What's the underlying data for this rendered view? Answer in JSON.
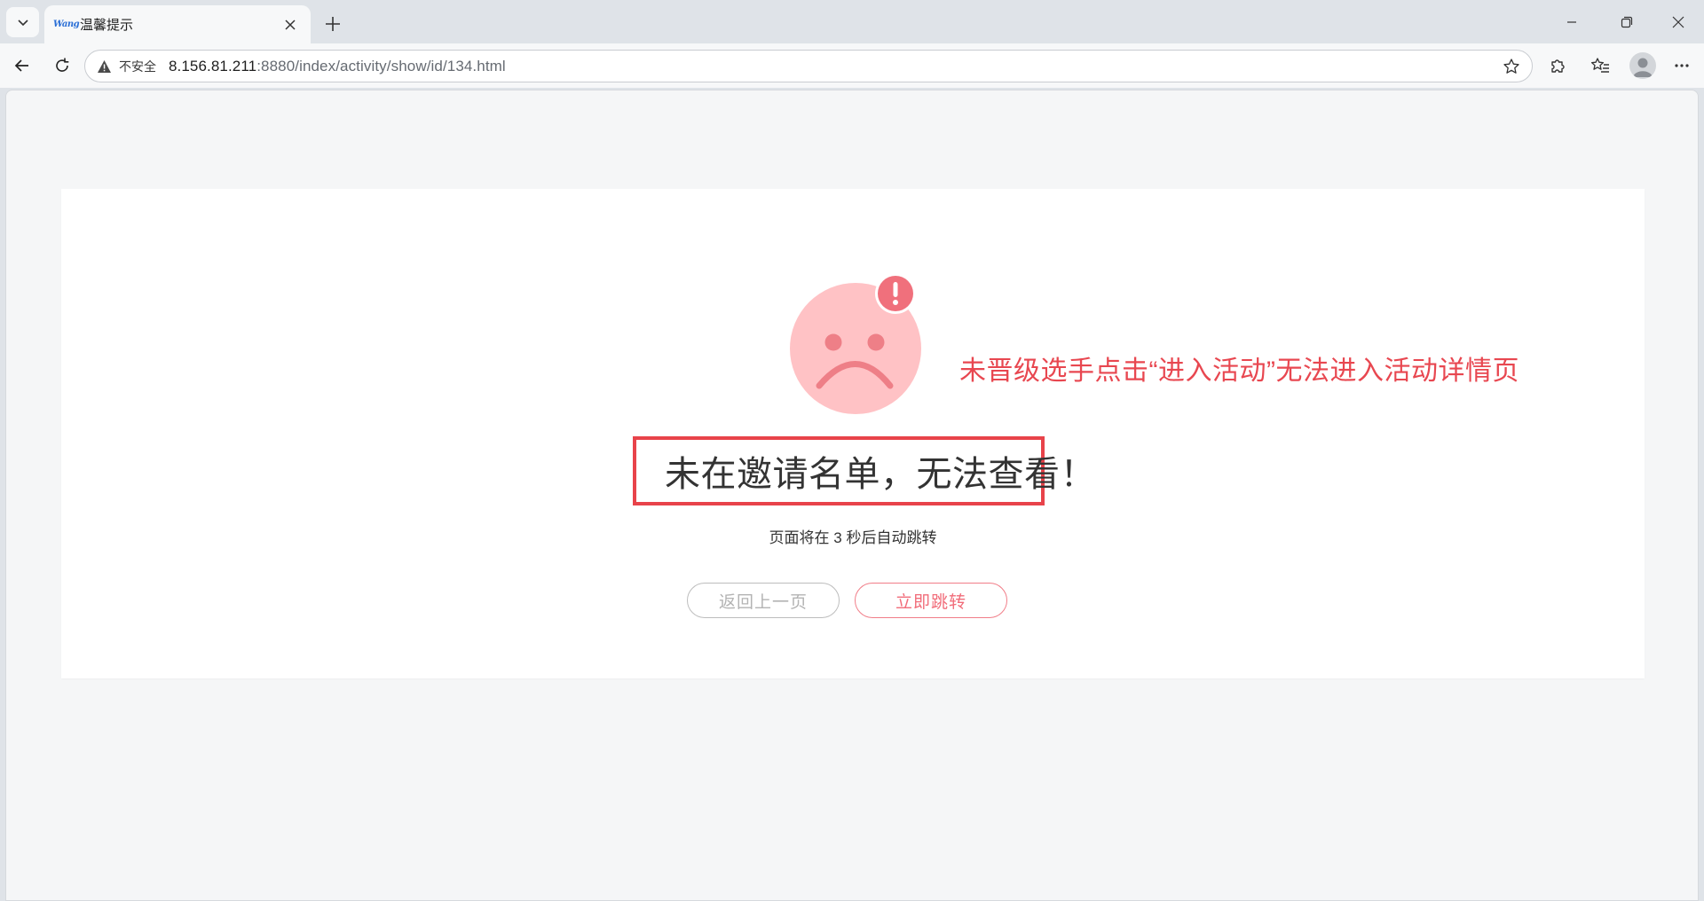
{
  "browser": {
    "tab": {
      "favicon_text": "Wang",
      "title": "温馨提示"
    },
    "address": {
      "security_label": "不安全",
      "url_host": "8.156.81.211",
      "url_path": ":8880/index/activity/show/id/134.html"
    },
    "icons": {
      "tab_menu": "chevron-down-icon",
      "tab_close": "close-icon",
      "new_tab": "plus-icon",
      "minimize": "minimize-icon",
      "restore": "restore-icon",
      "window_close": "close-icon",
      "back": "arrow-left-icon",
      "refresh": "refresh-icon",
      "warning": "warning-triangle-icon",
      "favorite": "star-icon",
      "extensions": "puzzle-icon",
      "favorites": "favorites-list-icon",
      "profile": "avatar",
      "more": "more-dots-icon"
    }
  },
  "page": {
    "annotation": "未晋级选手点击“进入活动”无法进入活动详情页",
    "message": "未在邀请名单，无法查看！",
    "countdown": "页面将在 3 秒后自动跳转",
    "buttons": {
      "back_label": "返回上一页",
      "jump_label": "立即跳转"
    },
    "colors": {
      "face": "#ffc2c5",
      "face_features": "#ee7f87",
      "alert_badge": "#f0707c",
      "annotation_red": "#e84750",
      "highlight_border": "#e8434a",
      "primary_button": "#f16d7a"
    }
  }
}
